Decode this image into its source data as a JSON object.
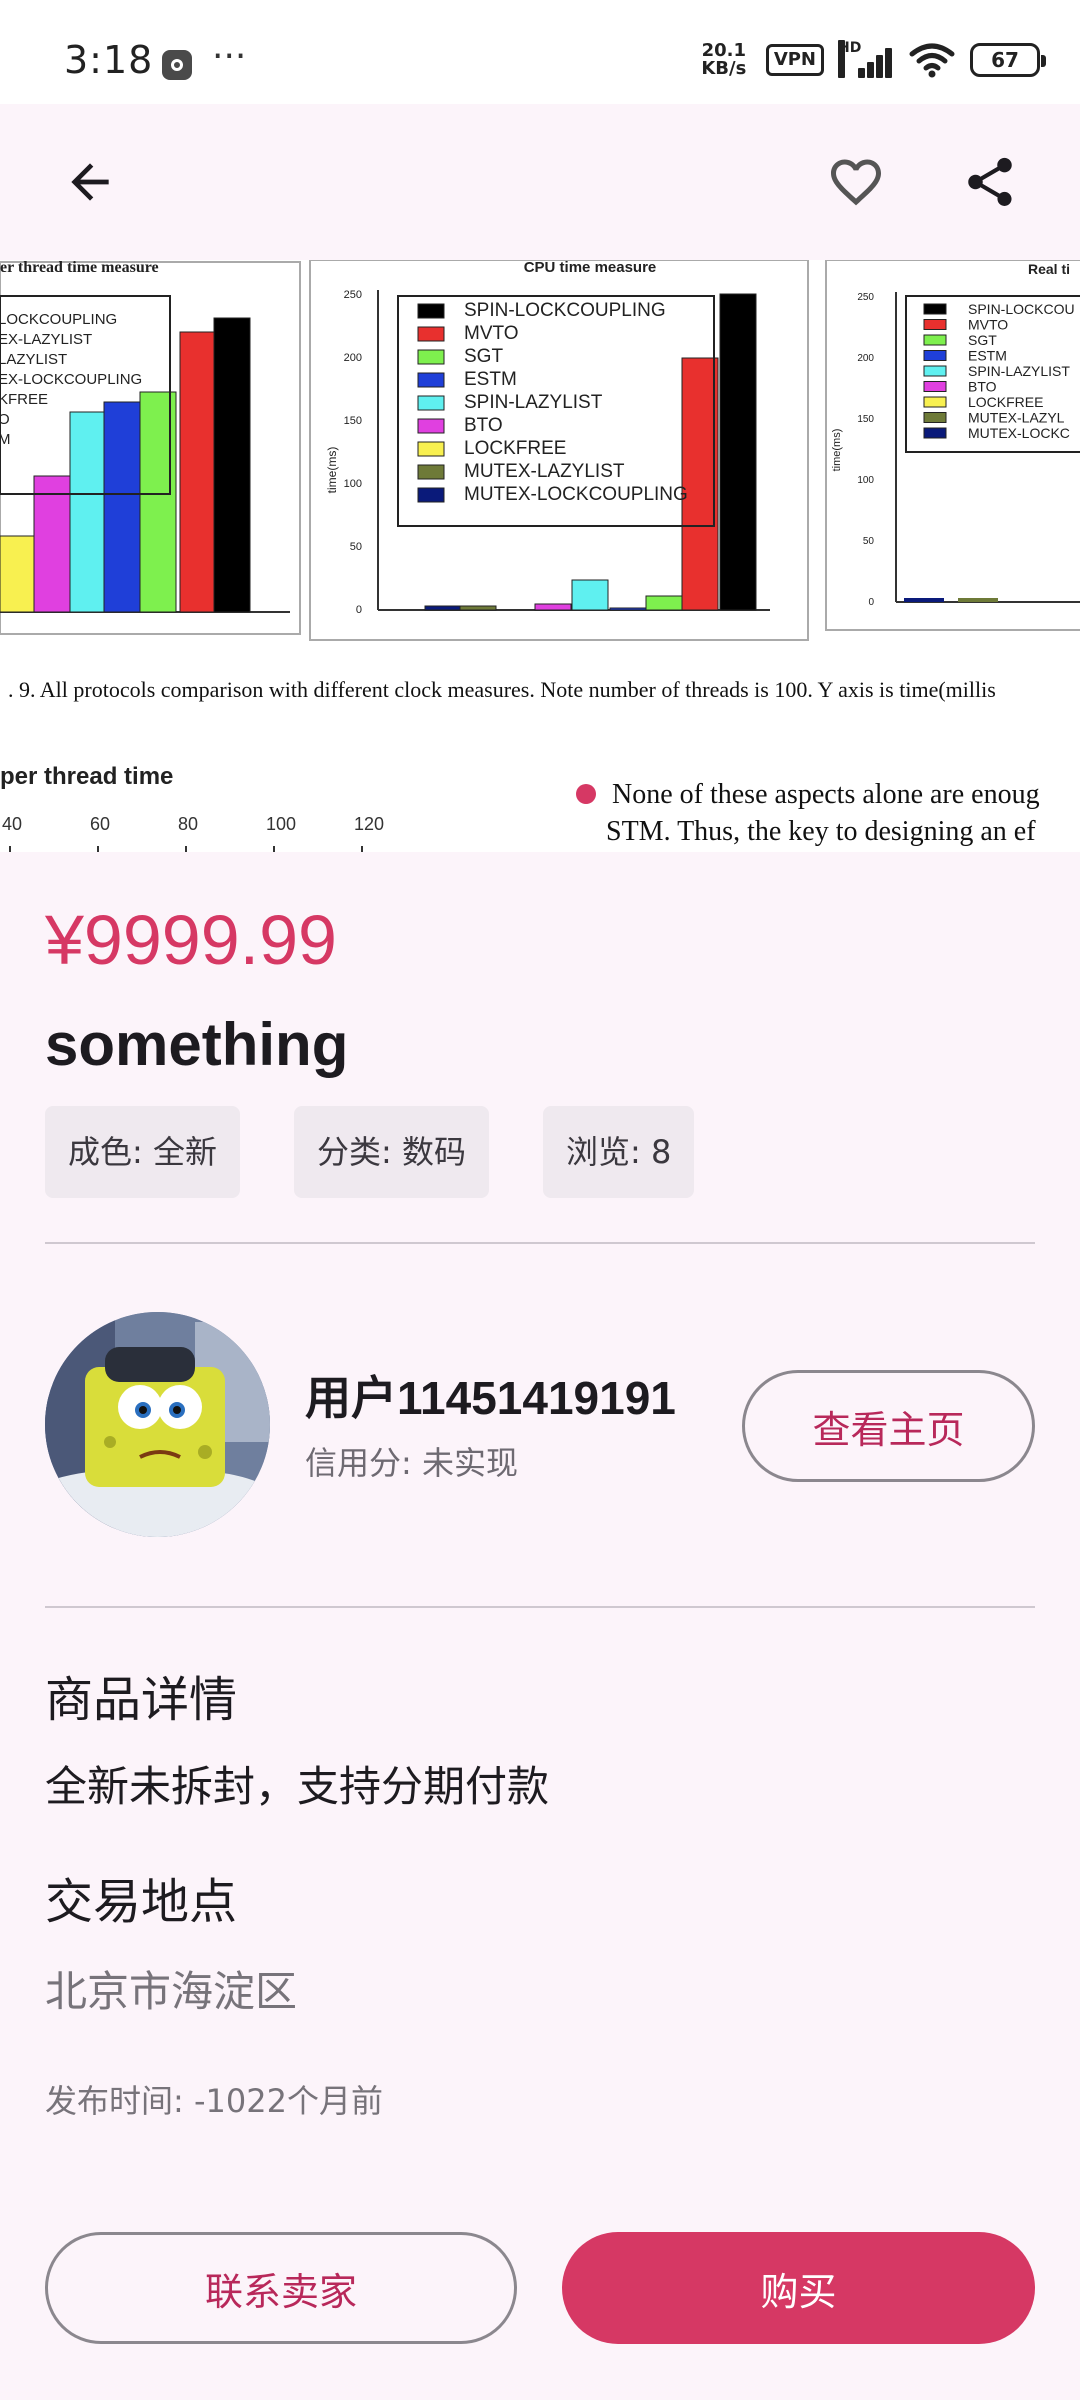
{
  "status_bar": {
    "time": "3:18",
    "dots": "···",
    "net_speed_value": "20.1",
    "net_speed_unit": "KB/s",
    "vpn": "VPN",
    "signal_label": "HD",
    "battery": "67"
  },
  "app_bar": {
    "back_icon": "arrow-back-icon",
    "favorite_icon": "heart-outline-icon",
    "share_icon": "share-icon"
  },
  "product_image": {
    "chart_left_title": "er thread time measure",
    "chart_left_legend": [
      "LOCKCOUPLING",
      "EX-LAZYLIST",
      "LAZYLIST",
      "EX-LOCKCOUPLING",
      "KFREE",
      "O",
      "M"
    ],
    "chart_mid_title": "CPU time measure",
    "chart_mid_ylabel": "time(ms)",
    "chart_mid_yticks": [
      "250",
      "200",
      "150",
      "100",
      "50",
      "0"
    ],
    "chart_mid_legend": [
      "SPIN-LOCKCOUPLING",
      "MVTO",
      "SGT",
      "ESTM",
      "SPIN-LAZYLIST",
      "BTO",
      "LOCKFREE",
      "MUTEX-LAZYLIST",
      "MUTEX-LOCKCOUPLING"
    ],
    "chart_right_title": "Real ti",
    "chart_right_ylabel": "time(ms)",
    "chart_right_yticks": [
      "250",
      "200",
      "150",
      "100",
      "50",
      "0"
    ],
    "chart_right_legend": [
      "SPIN-LOCKCOU",
      "MVTO",
      "SGT",
      "ESTM",
      "SPIN-LAZYLIST",
      "BTO",
      "LOCKFREE",
      "MUTEX-LAZYL",
      "MUTEX-LOCKC"
    ],
    "caption": ". 9. All protocols comparison with different clock measures. Note number of threads is 100. Y axis is time(millis",
    "sub_heading": "per thread time",
    "sub_ticks": [
      "40",
      "60",
      "80",
      "100",
      "120"
    ],
    "bullet_line_1": "None of these aspects alone are enoug",
    "bullet_line_2": "STM. Thus, the key to designing an ef",
    "legend_colors": [
      "#000000",
      "#E8302E",
      "#7EF04E",
      "#1F3FD8",
      "#5FF0F0",
      "#E040E0",
      "#F8F050",
      "#6E7A38",
      "#0A1A7A"
    ]
  },
  "product": {
    "price": "¥9999.99",
    "title": "something",
    "tags": [
      "成色: 全新",
      "分类: 数码",
      "浏览: 8"
    ]
  },
  "seller": {
    "name": "用户11451419191",
    "credit": "信用分: 未实现",
    "view_home_label": "查看主页"
  },
  "details": {
    "heading": "商品详情",
    "description": "全新未拆封，支持分期付款",
    "location_heading": "交易地点",
    "location": "北京市海淀区",
    "publish_time": "发布时间: -1022个月前"
  },
  "actions": {
    "contact_label": "联系卖家",
    "buy_label": "购买"
  },
  "colors": {
    "accent": "#D63864",
    "accent_text": "#B8285A",
    "background": "#FCF4FA",
    "chip_bg": "#EFE9EF"
  }
}
